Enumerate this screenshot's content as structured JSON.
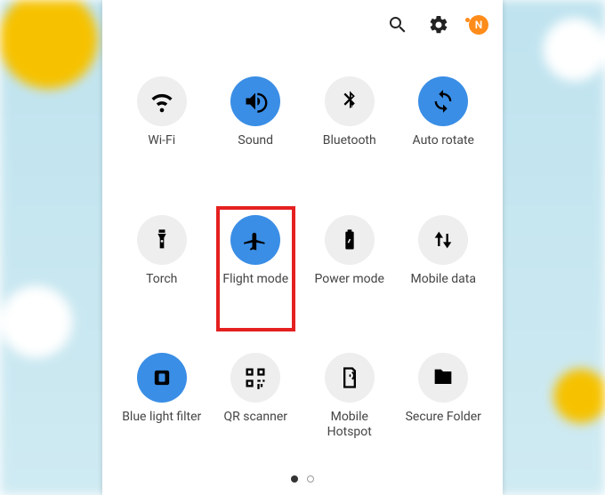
{
  "colors": {
    "accent": "#3a8ee6",
    "highlight": "#e52020",
    "avatar": "#ff8c1a"
  },
  "topbar": {
    "avatar_initial": "N"
  },
  "highlight_tile_index": 5,
  "tiles": [
    {
      "id": "wifi",
      "label": "Wi-Fi",
      "icon": "wifi",
      "active": false
    },
    {
      "id": "sound",
      "label": "Sound",
      "icon": "sound",
      "active": true
    },
    {
      "id": "bluetooth",
      "label": "Bluetooth",
      "icon": "bluetooth",
      "active": false
    },
    {
      "id": "autorotate",
      "label": "Auto rotate",
      "icon": "rotate",
      "active": true
    },
    {
      "id": "torch",
      "label": "Torch",
      "icon": "torch",
      "active": false
    },
    {
      "id": "flight",
      "label": "Flight mode",
      "icon": "airplane",
      "active": true
    },
    {
      "id": "power",
      "label": "Power mode",
      "icon": "battery",
      "active": false
    },
    {
      "id": "mobiledata",
      "label": "Mobile data",
      "icon": "updown",
      "active": false
    },
    {
      "id": "bluelight",
      "label": "Blue light filter",
      "icon": "bluelight",
      "active": true
    },
    {
      "id": "qr",
      "label": "QR scanner",
      "icon": "qr",
      "active": false
    },
    {
      "id": "hotspot",
      "label": "Mobile Hotspot",
      "icon": "hotspot",
      "active": false
    },
    {
      "id": "secure",
      "label": "Secure Folder",
      "icon": "folder",
      "active": false
    }
  ],
  "pager": {
    "total": 2,
    "current": 0
  }
}
